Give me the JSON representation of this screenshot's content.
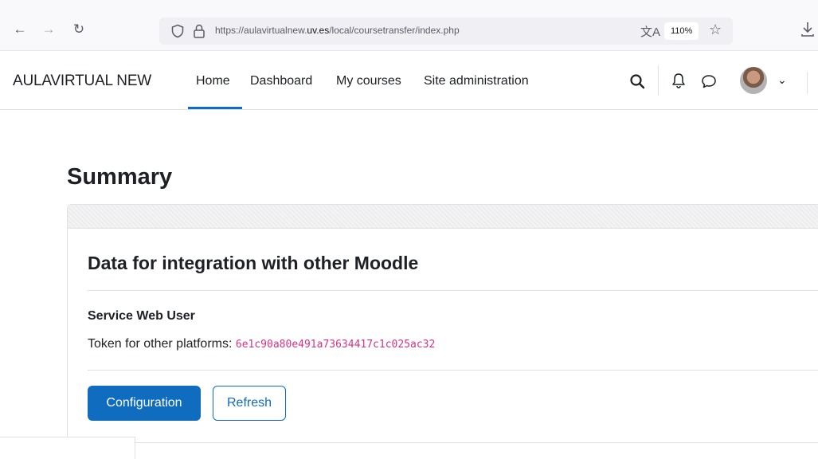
{
  "browser": {
    "url_prefix": "https://aulavirtualnew.",
    "url_domain": "uv.es",
    "url_path": "/local/coursetransfer/index.php",
    "zoom": "110%",
    "icons": [
      "back-arrow-icon",
      "forward-arrow-icon",
      "reload-icon",
      "shield-icon",
      "lock-icon",
      "translate-icon",
      "star-icon",
      "download-icon"
    ]
  },
  "navbar": {
    "brand": "AULAVIRTUAL NEW",
    "links": [
      "Home",
      "Dashboard",
      "My courses",
      "Site administration"
    ],
    "active_link": "Home",
    "accent_color": "#0f6cbf"
  },
  "page": {
    "title": "Summary",
    "card_title": "Data for integration with other Moodle",
    "section_label": "Service Web User",
    "token_label": "Token for other platforms:",
    "token_value": "6e1c90a80e491a73634417c1c025ac32",
    "token_color": "#d63384",
    "buttons": {
      "configuration": "Configuration",
      "refresh": "Refresh"
    }
  }
}
